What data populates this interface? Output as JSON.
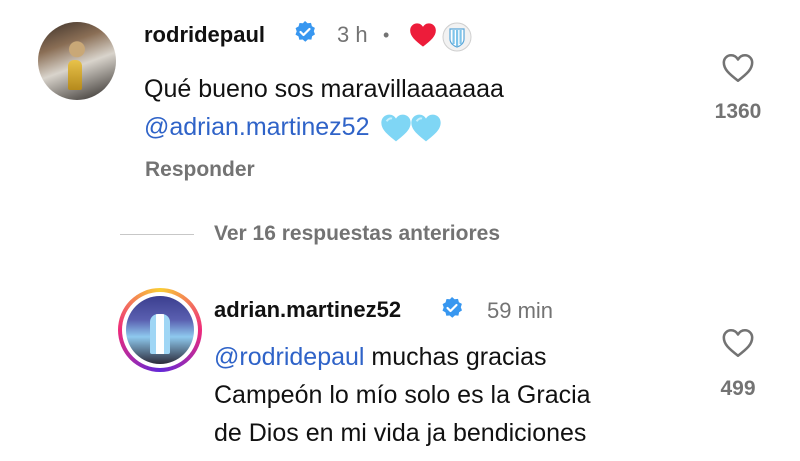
{
  "comments": [
    {
      "username": "rodridepaul",
      "time": "3 h",
      "separator": "•",
      "text": "Qué bueno sos maravillaaaaaaa",
      "mention": "@adrian.martinez52",
      "reply_label": "Responder",
      "like_count": "1360",
      "liked_by_creator": true
    },
    {
      "username": "adrian.martinez52",
      "time": "59 min",
      "mention": "@rodridepaul",
      "text_line1": " muchas gracias",
      "text_line2": "Campeón lo mío solo es la Gracia",
      "text_line3": "de Dios en mi vida ja bendiciones",
      "like_count": "499"
    }
  ],
  "view_replies_label": "Ver 16 respuestas anteriores",
  "colors": {
    "mention": "#2f63c8",
    "verified": "#3897f0",
    "secondary": "#737373",
    "heart_red": "#ed1c3a",
    "light_blue_heart": "#7fd6f5"
  }
}
